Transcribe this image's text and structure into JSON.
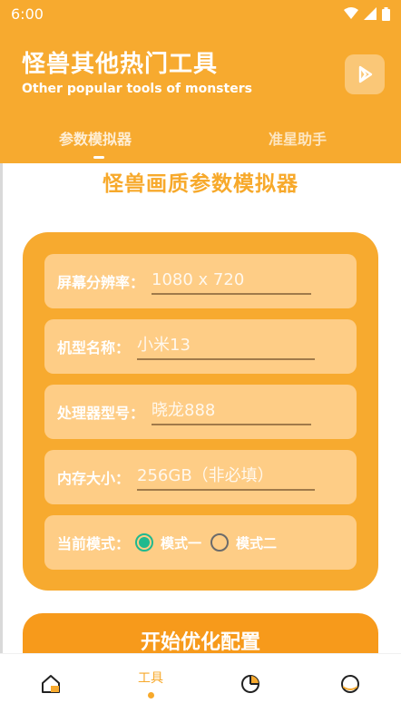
{
  "status_bar": {
    "time": "6:00"
  },
  "header": {
    "title": "怪兽其他热门工具",
    "subtitle": "Other popular tools of monsters"
  },
  "tabs": [
    {
      "label": "参数模拟器",
      "active": true
    },
    {
      "label": "准星助手",
      "active": false
    }
  ],
  "section_title": "怪兽画质参数模拟器",
  "form": {
    "resolution": {
      "label": "屏幕分辨率：",
      "placeholder": "1080 x 720"
    },
    "model": {
      "label": "机型名称：",
      "placeholder": "小米13"
    },
    "processor": {
      "label": "处理器型号：",
      "placeholder": "晓龙888"
    },
    "memory": {
      "label": "内存大小：",
      "placeholder": "256GB（非必填）"
    },
    "mode": {
      "label": "当前模式：",
      "options": [
        {
          "label": "模式一",
          "selected": true
        },
        {
          "label": "模式二",
          "selected": false
        }
      ]
    }
  },
  "start_button": "开始优化配置",
  "bottom_nav": [
    {
      "icon": "home-icon",
      "label": ""
    },
    {
      "icon": "tools",
      "label": "工具",
      "active": true
    },
    {
      "icon": "pie-chart-icon",
      "label": ""
    },
    {
      "icon": "profile-icon",
      "label": ""
    }
  ],
  "colors": {
    "primary": "#f7aa2f",
    "field_bg": "#fecd86",
    "radio_checked": "#1fb98e"
  }
}
